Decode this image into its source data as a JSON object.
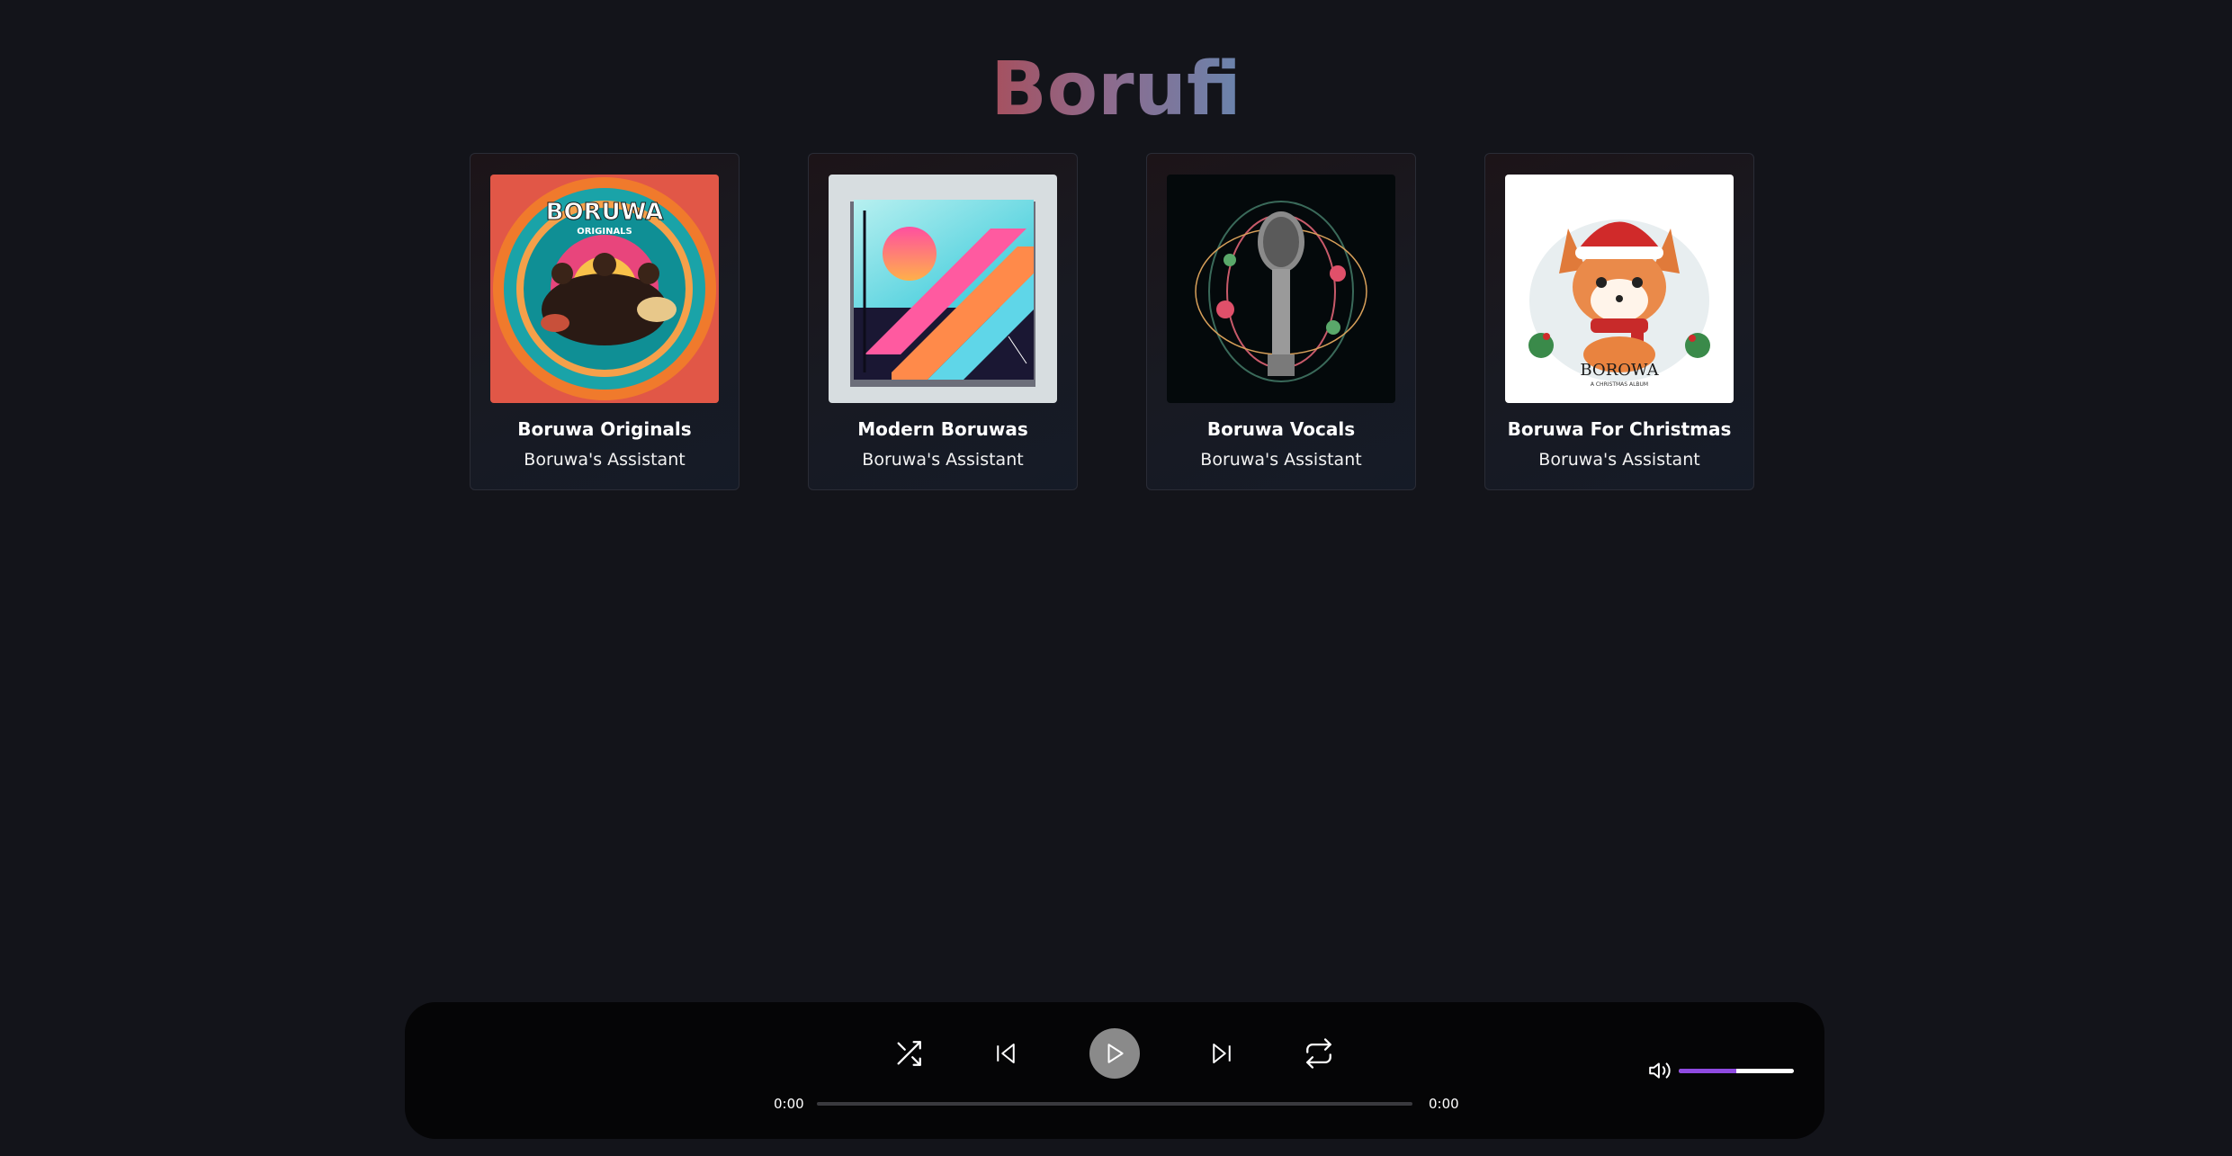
{
  "app": {
    "title": "Borufi"
  },
  "colors": {
    "background": "#13141a",
    "player_background": "#050506",
    "accent": "#8f4ae0",
    "title_gradient": [
      "#a6505e",
      "#6a84ad"
    ]
  },
  "playlists": [
    {
      "title": "Boruwa Originals",
      "subtitle": "Boruwa's Assistant",
      "cover_text": "BORUWA",
      "cover_subtext": "ORIGINALS"
    },
    {
      "title": "Modern Boruwas",
      "subtitle": "Boruwa's Assistant"
    },
    {
      "title": "Boruwa Vocals",
      "subtitle": "Boruwa's Assistant"
    },
    {
      "title": "Boruwa For Christmas",
      "subtitle": "Boruwa's Assistant",
      "cover_text": "BOROWA",
      "cover_subtext": "A CHRISTMAS ALBUM"
    }
  ],
  "player": {
    "controls": [
      {
        "name": "shuffle-icon"
      },
      {
        "name": "previous-icon"
      },
      {
        "name": "play-icon"
      },
      {
        "name": "next-icon"
      },
      {
        "name": "repeat-icon"
      }
    ],
    "current_time": "0:00",
    "duration": "0:00",
    "progress": 0,
    "volume": 0.5,
    "volume_icon": "volume-icon"
  }
}
